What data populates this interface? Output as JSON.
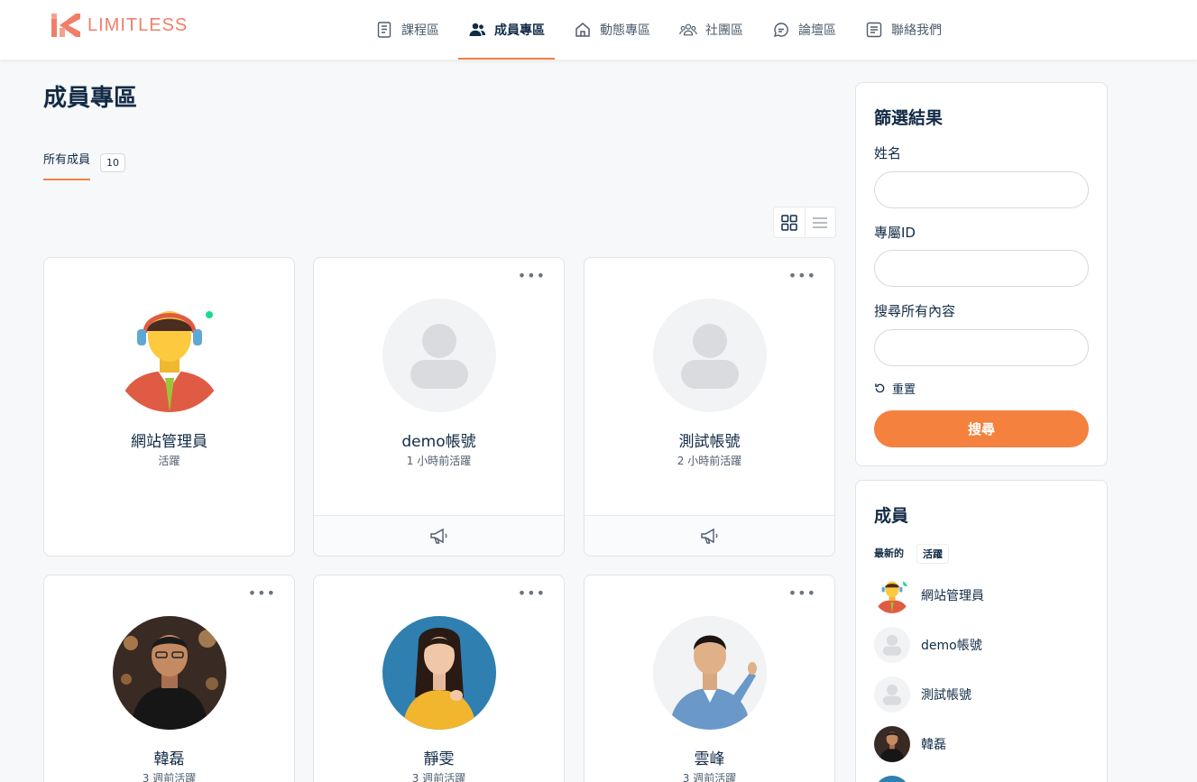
{
  "brand": {
    "name": "LIMITLESS",
    "color": "#f07f6a"
  },
  "colors": {
    "accent": "#f5813f",
    "online": "#1cd991"
  },
  "nav": [
    {
      "label": "課程區",
      "icon": "document-icon",
      "active": false
    },
    {
      "label": "成員專區",
      "icon": "users-icon",
      "active": true
    },
    {
      "label": "動態專區",
      "icon": "home-icon",
      "active": false
    },
    {
      "label": "社團區",
      "icon": "group-icon",
      "active": false
    },
    {
      "label": "論壇區",
      "icon": "chat-icon",
      "active": false
    },
    {
      "label": "聯絡我們",
      "icon": "contact-card-icon",
      "active": false
    }
  ],
  "main": {
    "title": "成員專區",
    "tab_all": {
      "label": "所有成員",
      "count": "10"
    },
    "view_modes": [
      "grid-icon",
      "list-icon"
    ],
    "more_label": "•••",
    "members": [
      {
        "name": "網站管理員",
        "status": "活躍",
        "avatar": "admin",
        "online": true,
        "has_footer": false
      },
      {
        "name": "demo帳號",
        "status": "1 小時前活躍",
        "avatar": "placeholder",
        "online": false,
        "has_footer": true
      },
      {
        "name": "測試帳號",
        "status": "2 小時前活躍",
        "avatar": "placeholder",
        "online": false,
        "has_footer": true
      },
      {
        "name": "韓磊",
        "status": "3 週前活躍",
        "avatar": "photo-man-street",
        "online": false,
        "has_footer": false
      },
      {
        "name": "靜雯",
        "status": "3 週前活躍",
        "avatar": "photo-woman-yellow",
        "online": false,
        "has_footer": false
      },
      {
        "name": "雲峰",
        "status": "3 週前活躍",
        "avatar": "photo-man-denim",
        "online": false,
        "has_footer": false
      }
    ]
  },
  "filter": {
    "title": "篩選結果",
    "name_label": "姓名",
    "name_value": "",
    "id_label": "專屬ID",
    "id_value": "",
    "all_label": "搜尋所有內容",
    "all_value": "",
    "reset_label": "重置",
    "search_label": "搜尋"
  },
  "members_widget": {
    "title": "成員",
    "tab_newest": "最新的",
    "tab_active": "活躍",
    "list": [
      {
        "name": "網站管理員",
        "avatar": "admin",
        "online": true
      },
      {
        "name": "demo帳號",
        "avatar": "placeholder",
        "online": false
      },
      {
        "name": "測試帳號",
        "avatar": "placeholder",
        "online": false
      },
      {
        "name": "韓磊",
        "avatar": "photo-man-street",
        "online": false
      }
    ]
  }
}
